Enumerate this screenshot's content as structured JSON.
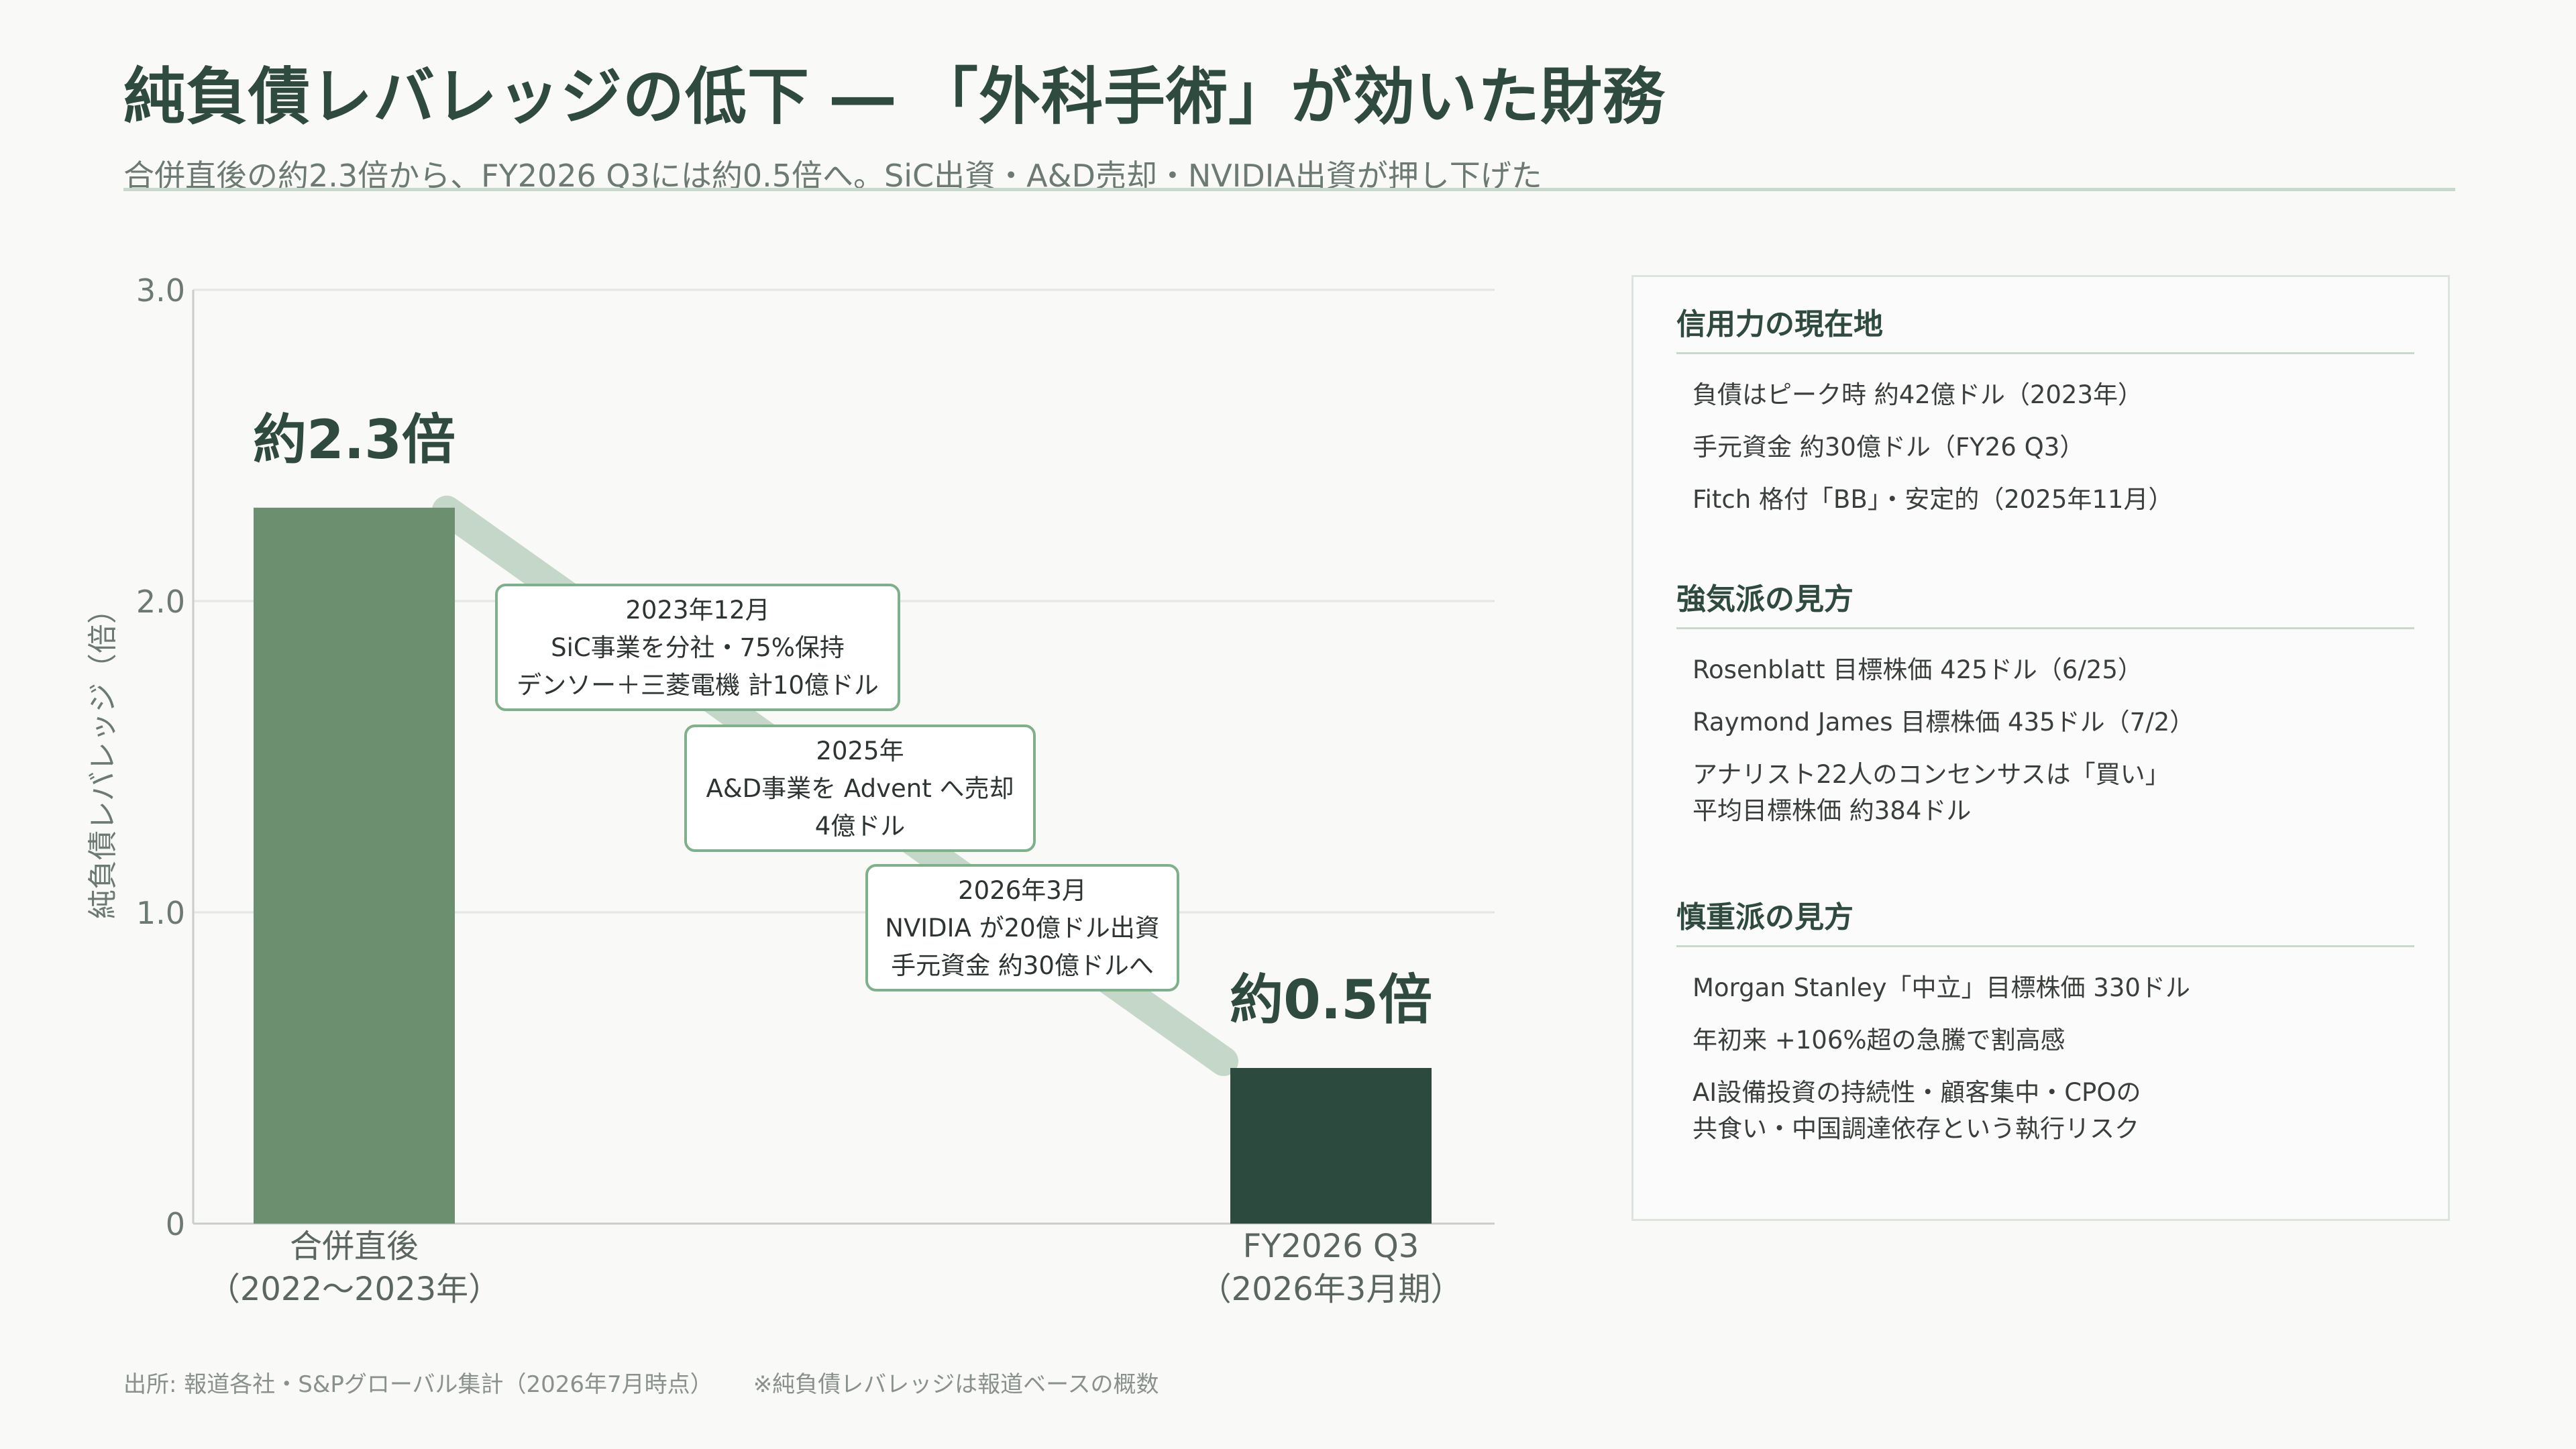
{
  "header": {
    "title": "純負債レバレッジの低下 ― 「外科手術」が効いた財務",
    "subtitle": "合併直後の約2.3倍から、FY2026 Q3には約0.5倍へ。SiC出資・A&D売却・NVIDIA出資が押し下げた"
  },
  "chart_data": {
    "type": "bar",
    "categories": [
      "合併直後\n（2022〜2023年）",
      "FY2026 Q3\n（2026年3月期）"
    ],
    "values": [
      2.3,
      0.5
    ],
    "value_labels": [
      "約2.3倍",
      "約0.5倍"
    ],
    "ylabel": "純負債レバレッジ（倍）",
    "ylim": [
      0,
      3.0
    ],
    "yticks": [
      "0",
      "1.0",
      "2.0",
      "3.0"
    ],
    "ytick_values": [
      0,
      1.0,
      2.0,
      3.0
    ],
    "grid": true,
    "bar_colors": [
      "#6b8f6f",
      "#2d4a3e"
    ],
    "annotations": [
      {
        "lines": [
          "2023年12月",
          "SiC事業を分社・75%保持",
          "デンソー＋三菱電機 計10億ドル"
        ]
      },
      {
        "lines": [
          "2025年",
          "A&D事業を Advent へ売却",
          "4億ドル"
        ]
      },
      {
        "lines": [
          "2026年3月",
          "NVIDIA が20億ドル出資",
          "手元資金 約30億ドルへ"
        ]
      }
    ]
  },
  "panel": {
    "sections": [
      {
        "heading": "信用力の現在地",
        "items": [
          "負債はピーク時 約42億ドル（2023年）",
          "手元資金 約30億ドル（FY26 Q3）",
          "Fitch 格付「BB」・安定的（2025年11月）"
        ]
      },
      {
        "heading": "強気派の見方",
        "items": [
          "Rosenblatt 目標株価 425ドル（6/25）",
          "Raymond James 目標株価 435ドル（7/2）",
          "アナリスト22人のコンセンサスは「買い」\n平均目標株価 約384ドル"
        ]
      },
      {
        "heading": "慎重派の見方",
        "items": [
          "Morgan Stanley「中立」目標株価 330ドル",
          "年初来 +106%超の急騰で割高感",
          "AI設備投資の持続性・顧客集中・CPOの\n共食い・中国調達依存という執行リスク"
        ]
      }
    ]
  },
  "footer": {
    "source": "出所: 報道各社・S&Pグローバル集計（2026年7月時点）",
    "note": "※純負債レバレッジは報道ベースの概数"
  }
}
